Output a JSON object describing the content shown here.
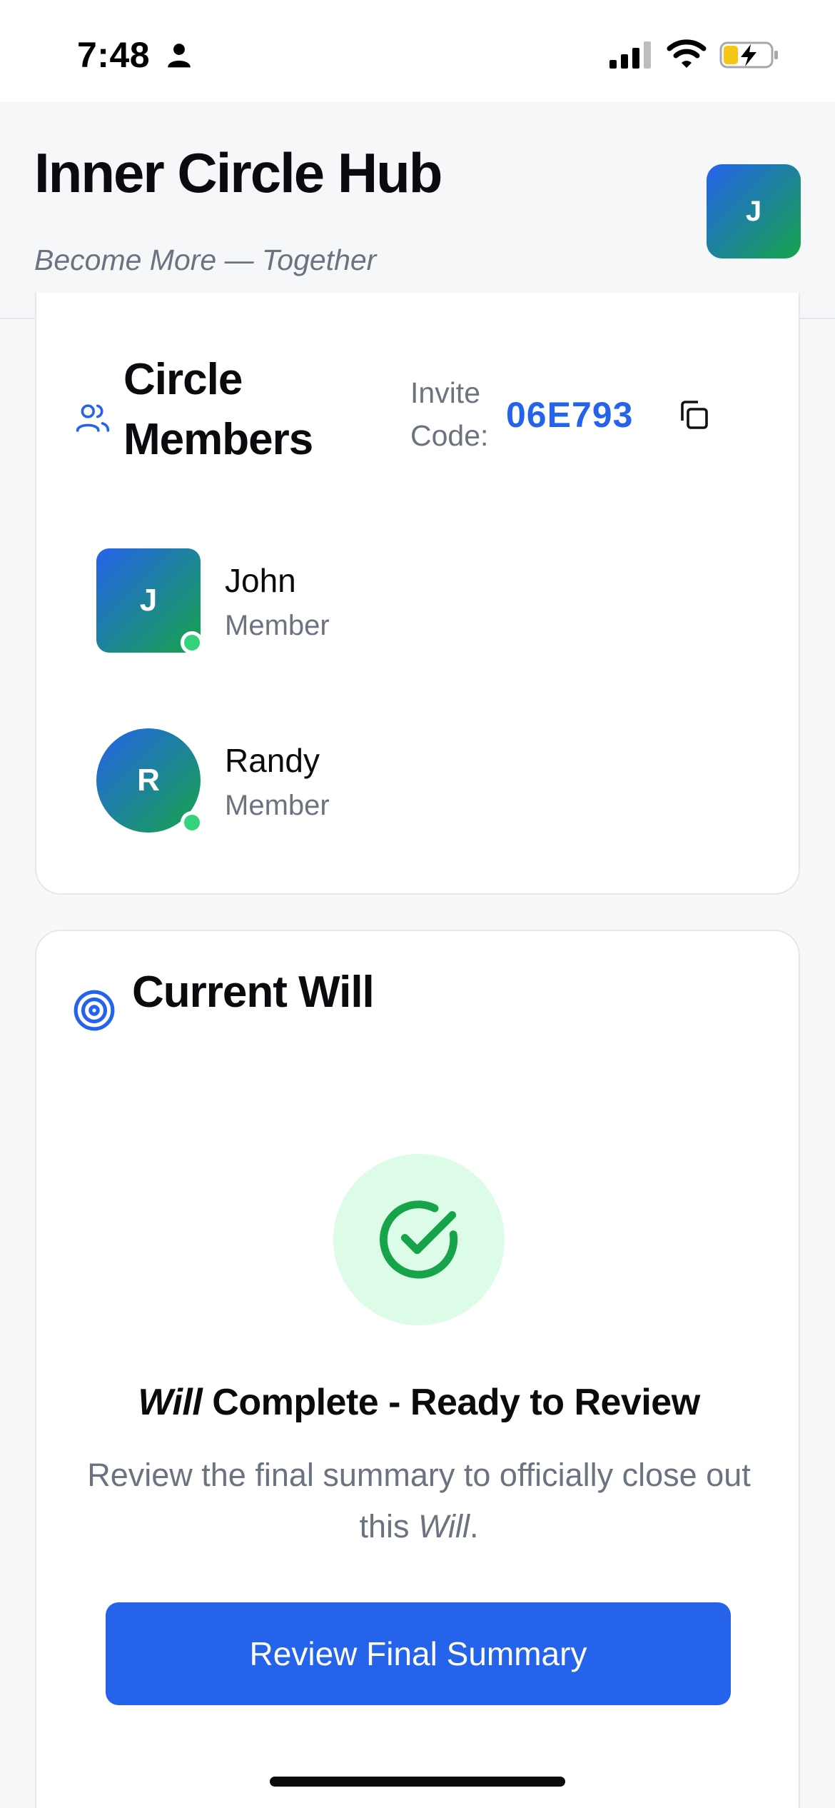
{
  "status_bar": {
    "time": "7:48",
    "icons": [
      "person-icon",
      "signal-icon",
      "wifi-icon",
      "battery-charging-icon"
    ]
  },
  "header": {
    "title": "Inner Circle Hub",
    "tagline": "Become More — Together",
    "avatar_initial": "J"
  },
  "members_card": {
    "title": "Circle Members",
    "icon": "users-icon",
    "invite_label": "Invite Code:",
    "invite_code": "06E793",
    "copy_icon": "copy-icon",
    "members": [
      {
        "initial": "J",
        "name": "John",
        "role": "Member",
        "online": true
      },
      {
        "initial": "R",
        "name": "Randy",
        "role": "Member",
        "online": true
      }
    ]
  },
  "will_card": {
    "title": "Current Will",
    "icon": "target-icon",
    "status_icon": "check-circle-icon",
    "status_emphasis": "Will",
    "status_rest": " Complete - Ready to Review",
    "description_before": "Review the final summary to officially close out this ",
    "description_emphasis": "Will",
    "description_after": ".",
    "button_label": "Review Final Summary"
  },
  "colors": {
    "accent": "#2563eb",
    "success": "#16a34a",
    "success_bg": "#dcfce7",
    "online": "#34d27a",
    "muted_text": "#6b7280"
  }
}
